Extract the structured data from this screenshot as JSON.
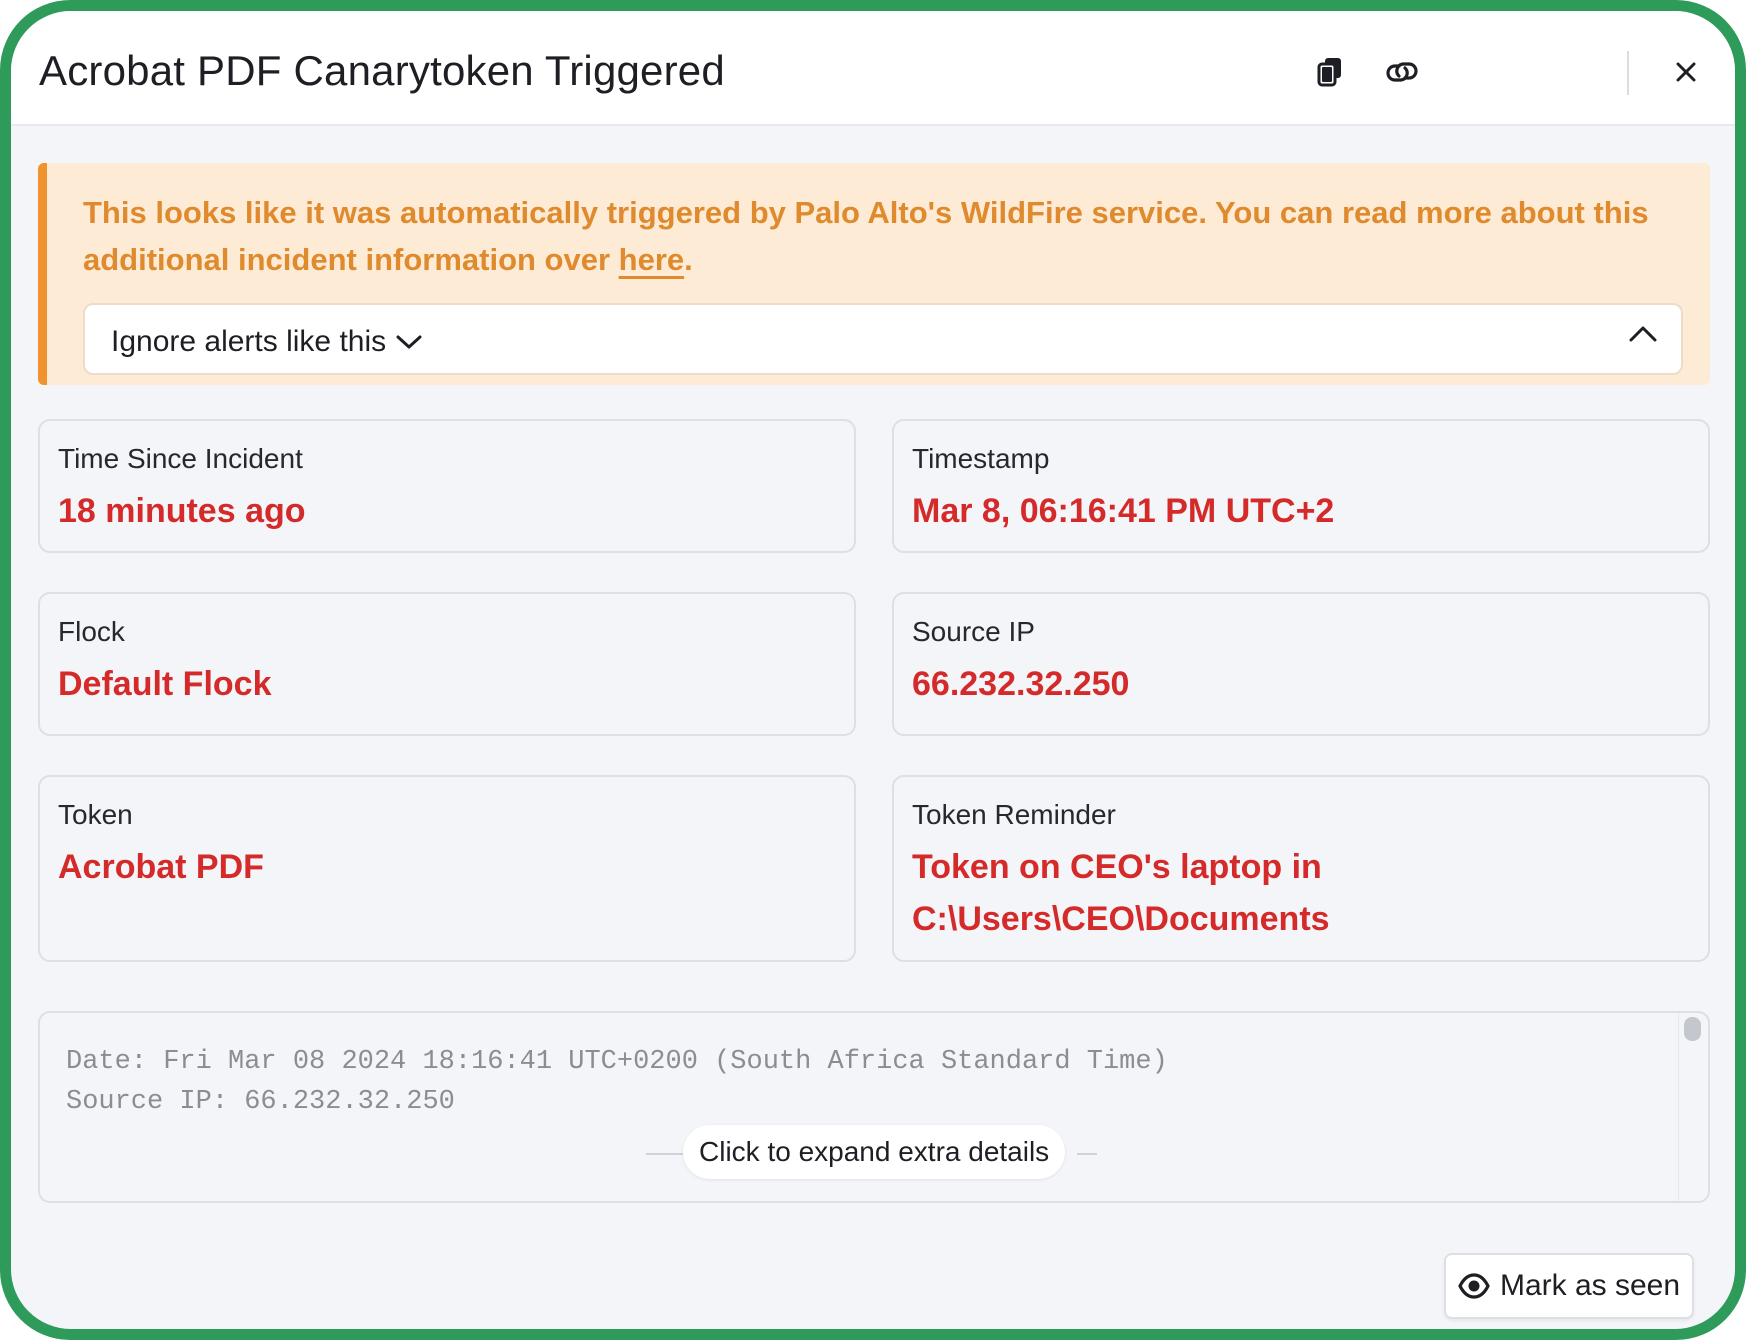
{
  "window": {
    "title": "Acrobat PDF Canarytoken Triggered",
    "copy_icon": "copy-icon",
    "link_icon": "link-icon",
    "close_icon": "close-icon"
  },
  "alert": {
    "message": "This looks like it was automatically triggered by Palo Alto's WildFire service. You can read more about this additional incident information over ",
    "link_text": "here",
    "suffix": ".",
    "ignore_label": "Ignore alerts like this",
    "accent_color": "#f0922e"
  },
  "cards": [
    {
      "label": "Time Since Incident",
      "value": "18 minutes ago"
    },
    {
      "label": "Timestamp",
      "value": "Mar 8, 06:16:41 PM UTC+2"
    },
    {
      "label": "Flock",
      "value": "Default Flock"
    },
    {
      "label": "Source IP",
      "value": "66.232.32.250"
    },
    {
      "label": "Token",
      "value": "Acrobat PDF"
    },
    {
      "label": "Token Reminder",
      "value_line1": "Token on CEO's laptop in",
      "value_line2": "C:\\Users\\CEO\\Documents"
    }
  ],
  "log": {
    "lines": [
      "Date: Fri Mar 08 2024 18:16:41 UTC+0200 (South Africa Standard Time)",
      "Source IP: 66.232.32.250"
    ],
    "expand_label": "Click to expand extra details"
  },
  "footer": {
    "mark_seen_label": "Mark as seen",
    "eye_icon": "eye-icon"
  },
  "colors": {
    "frame": "#2e9b5a",
    "value_red": "#d42a2a",
    "alert_text": "#e08a2e",
    "alert_bg": "#fdebd6"
  }
}
